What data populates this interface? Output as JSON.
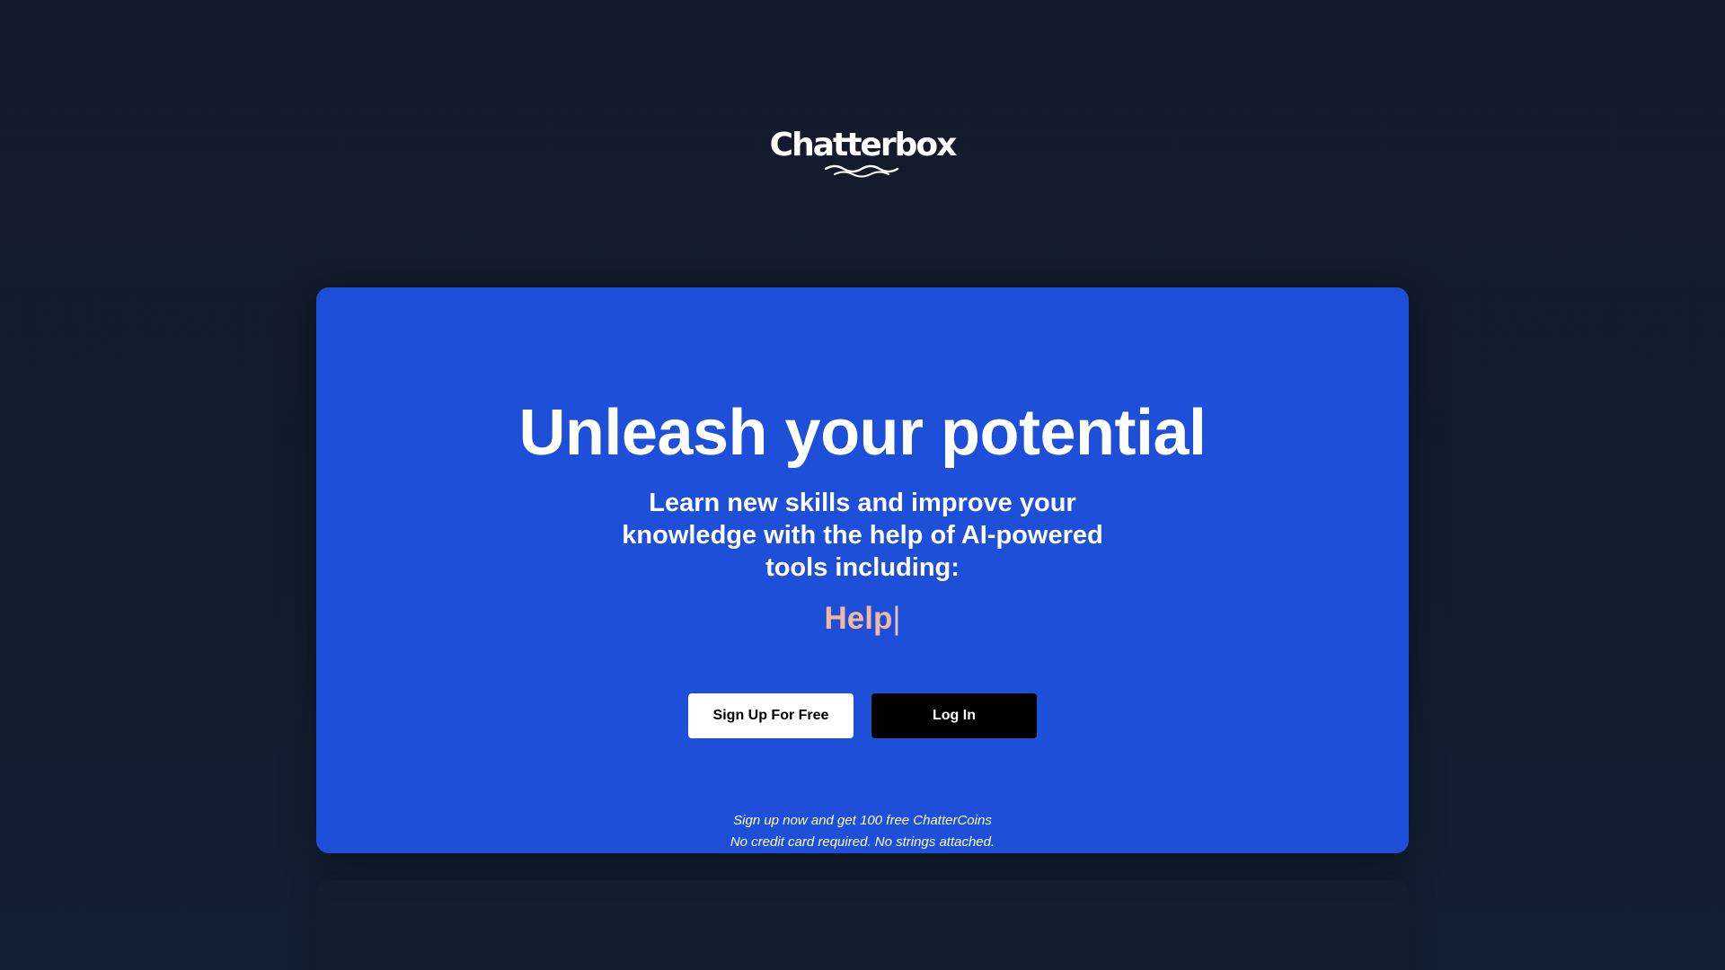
{
  "brand": {
    "name": "Chatterbox"
  },
  "hero": {
    "title": "Unleash your potential",
    "subtitle": "Learn new skills and improve your knowledge with the help of AI-powered tools including:",
    "typed_word": "Help",
    "cursor": "|",
    "signup_label": "Sign Up For Free",
    "login_label": "Log In",
    "fine_print_line1": "Sign up now and get 100 free ChatterCoins",
    "fine_print_line2": "No credit card required. No strings attached."
  },
  "colors": {
    "page_background": "#131a2b",
    "card_background": "#1e4fd8",
    "typed_word": "#f2b8a0",
    "signup_button": "#ffffff",
    "login_button": "#000000"
  },
  "icons": {
    "logo_waves": "waves-icon"
  }
}
